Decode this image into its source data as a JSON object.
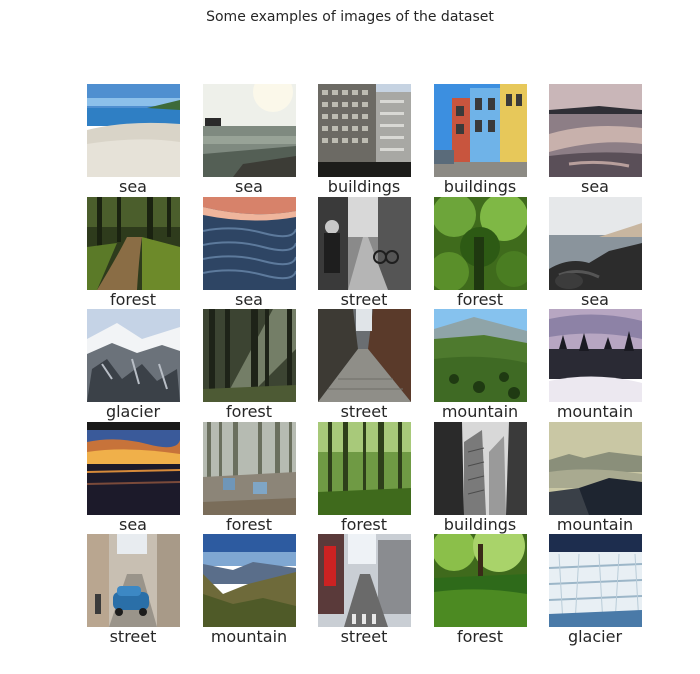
{
  "figure": {
    "title": "Some examples of images of the dataset"
  },
  "images": [
    {
      "label": "sea",
      "scene": "beach"
    },
    {
      "label": "sea",
      "scene": "sea-pier"
    },
    {
      "label": "buildings",
      "scene": "buildings-gray"
    },
    {
      "label": "buildings",
      "scene": "buildings-colorful"
    },
    {
      "label": "sea",
      "scene": "sea-dusk-shore"
    },
    {
      "label": "forest",
      "scene": "forest-path"
    },
    {
      "label": "sea",
      "scene": "sea-waves"
    },
    {
      "label": "street",
      "scene": "street-bw"
    },
    {
      "label": "forest",
      "scene": "forest-green"
    },
    {
      "label": "sea",
      "scene": "sea-rocks"
    },
    {
      "label": "glacier",
      "scene": "glacier-mountain"
    },
    {
      "label": "forest",
      "scene": "forest-sunrays"
    },
    {
      "label": "street",
      "scene": "street-alley"
    },
    {
      "label": "mountain",
      "scene": "mountain-valley"
    },
    {
      "label": "mountain",
      "scene": "mountain-snow-trees"
    },
    {
      "label": "sea",
      "scene": "sea-sunset"
    },
    {
      "label": "forest",
      "scene": "forest-chairs"
    },
    {
      "label": "forest",
      "scene": "forest-green-trunks"
    },
    {
      "label": "buildings",
      "scene": "buildings-skyscrapers"
    },
    {
      "label": "mountain",
      "scene": "mountain-haze"
    },
    {
      "label": "street",
      "scene": "street-car"
    },
    {
      "label": "mountain",
      "scene": "mountain-canyon"
    },
    {
      "label": "street",
      "scene": "street-city"
    },
    {
      "label": "forest",
      "scene": "forest-pond"
    },
    {
      "label": "glacier",
      "scene": "glacier-ice"
    }
  ]
}
